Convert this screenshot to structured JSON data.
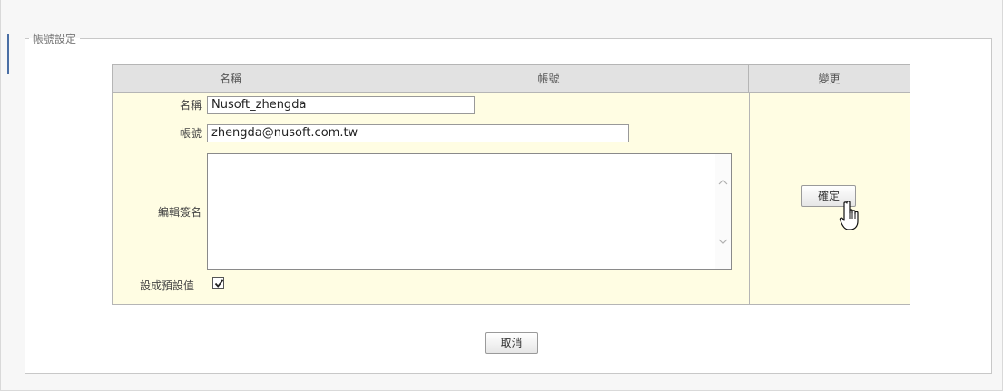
{
  "group": {
    "title": "帳號設定"
  },
  "table": {
    "headers": {
      "name": "名稱",
      "account": "帳號",
      "change": "變更"
    }
  },
  "form": {
    "name_label": "名稱",
    "name_value": "Nusoft_zhengda",
    "account_label": "帳號",
    "account_value": "zhengda@nusoft.com.tw",
    "signature_label": "編輯簽名",
    "signature_value": "",
    "default_label": "設成預設值",
    "default_checked": true
  },
  "buttons": {
    "confirm": "確定",
    "cancel": "取消"
  },
  "icons": {
    "scroll_up": "chevron-up-icon",
    "scroll_down": "chevron-down-icon",
    "cursor": "hand-pointer-icon",
    "check": "checkmark-icon"
  },
  "colors": {
    "row_bg": "#fffde3",
    "header_bg": "#e2e2e2",
    "accent": "#4a6fa5"
  }
}
